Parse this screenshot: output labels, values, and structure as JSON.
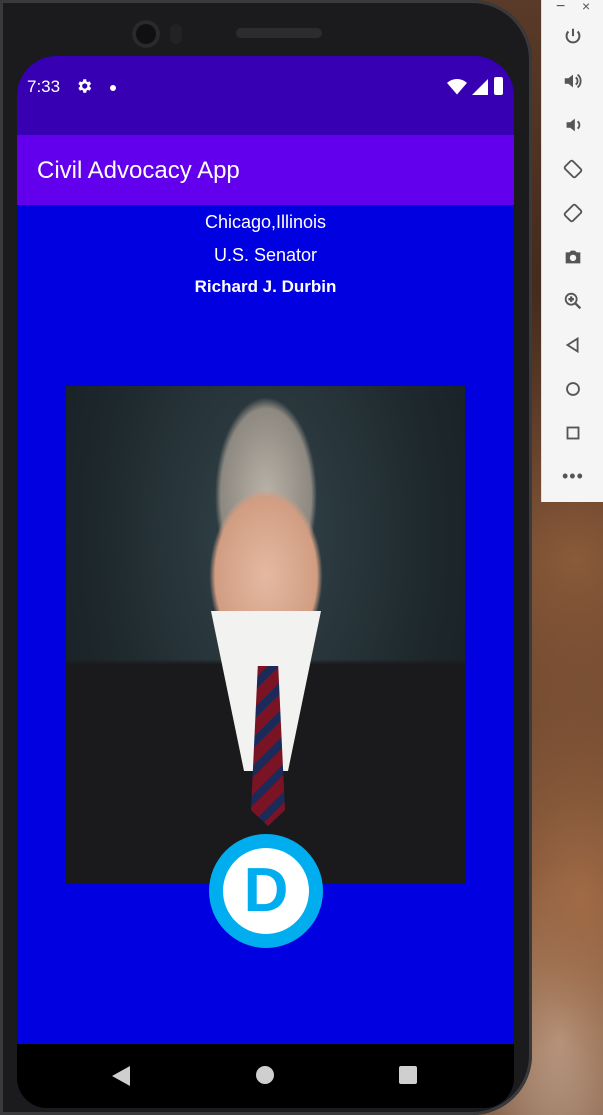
{
  "status_bar": {
    "time": "7:33",
    "icons": [
      "gear-icon",
      "notification-dot-icon",
      "wifi-icon",
      "signal-icon",
      "battery-icon"
    ]
  },
  "app_bar": {
    "title": "Civil Advocacy App"
  },
  "official": {
    "location": "Chicago,Illinois",
    "office": "U.S. Senator",
    "name": "Richard J. Durbin",
    "party_logo_letter": "D"
  },
  "navigation": {
    "buttons": [
      "back-icon",
      "home-icon",
      "recents-icon"
    ]
  },
  "emulator_toolbar": {
    "window_minimize": "−",
    "window_close": "×",
    "tools": [
      "power-icon",
      "volume-up-icon",
      "volume-down-icon",
      "rotate-left-icon",
      "rotate-right-icon",
      "camera-icon",
      "zoom-icon",
      "back-icon",
      "home-icon",
      "overview-icon"
    ],
    "more": "•••"
  },
  "colors": {
    "status_bar": "#3700b3",
    "app_bar": "#6200ee",
    "background": "#0000e0",
    "party_blue": "#00aeef"
  }
}
